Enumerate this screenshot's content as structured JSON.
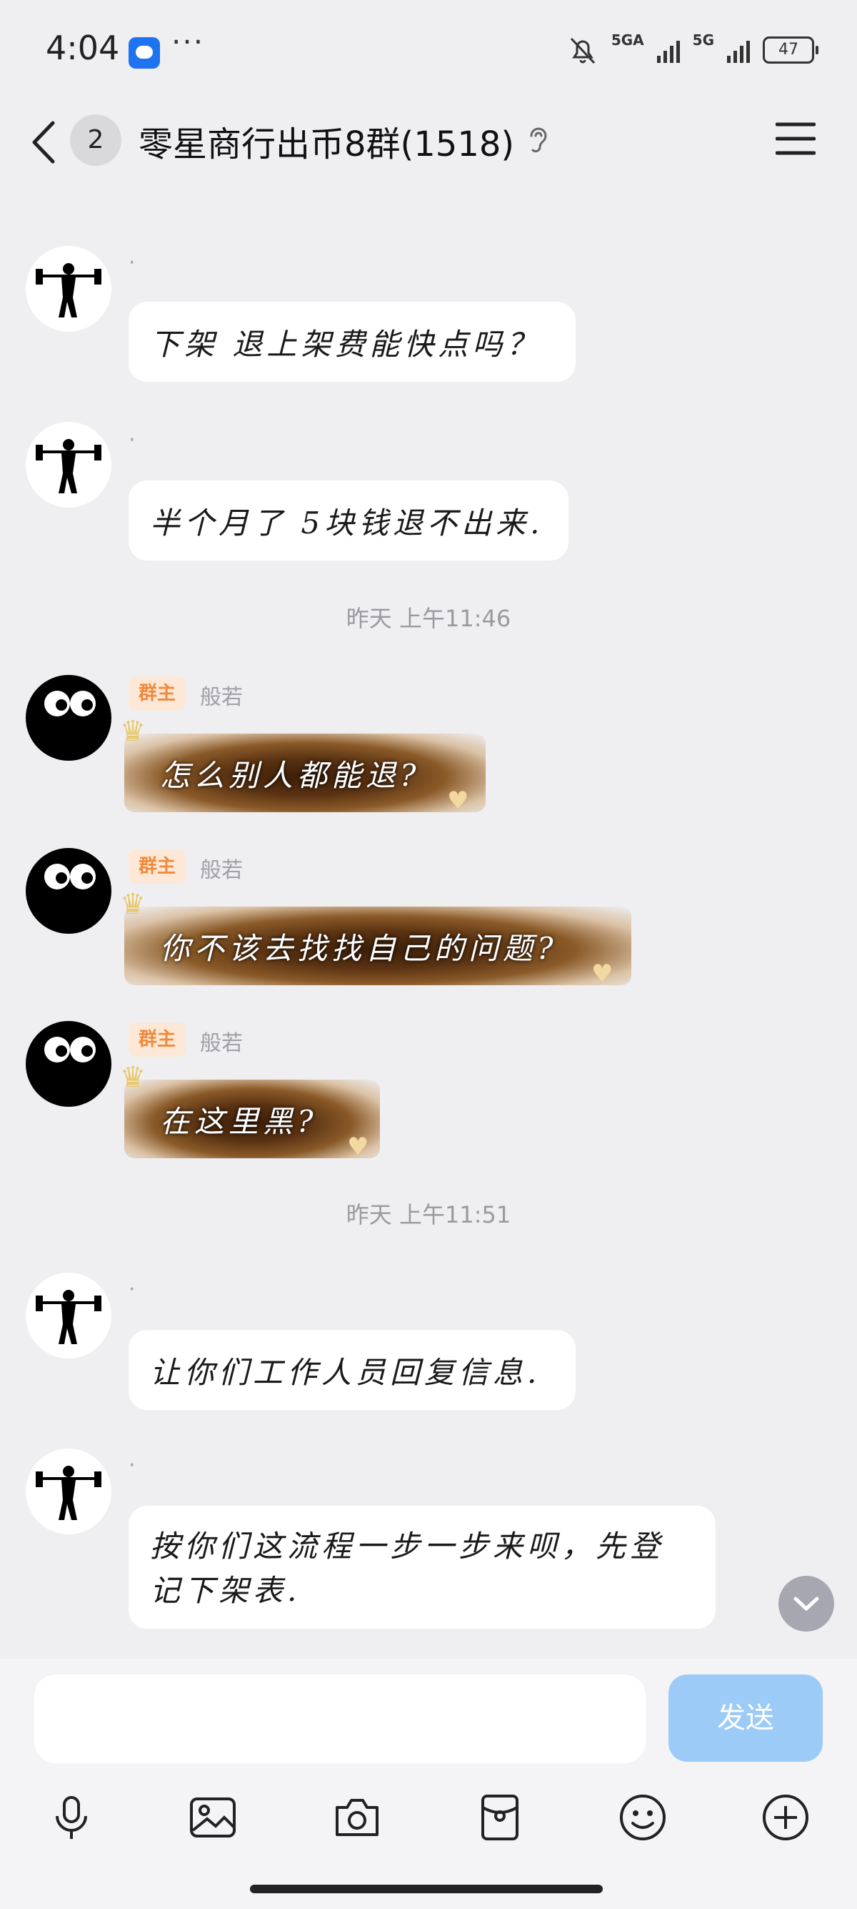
{
  "status_bar": {
    "time": "4:04",
    "more": "···",
    "network1": "5GA",
    "network2": "5G",
    "battery": "47"
  },
  "header": {
    "unread_count": "2",
    "title": "零星商行出币8群(1518)"
  },
  "timestamps": [
    "昨天 上午11:46",
    "昨天 上午11:51"
  ],
  "messages": [
    {
      "sender": "·",
      "text": "下架 退上架费能快点吗？"
    },
    {
      "sender": "·",
      "text": "半个月了 5块钱退不出来."
    },
    {
      "badge": "群主",
      "sender": "般若",
      "text": "怎么别人都能退?"
    },
    {
      "badge": "群主",
      "sender": "般若",
      "text": "你不该去找找自己的问题?"
    },
    {
      "badge": "群主",
      "sender": "般若",
      "text": "在这里黑?"
    },
    {
      "sender": "·",
      "text": "让你们工作人员回复信息."
    },
    {
      "sender": "·",
      "text_line1": "按你们这流程一步一步来呗，先登",
      "text_line2": "记下架表."
    }
  ],
  "input": {
    "placeholder": "",
    "send_label": "发送"
  },
  "toolbar": [
    "mic-icon",
    "image-icon",
    "camera-icon",
    "red-packet-icon",
    "emoji-icon",
    "plus-icon"
  ],
  "colors": {
    "background": "#efeff2",
    "send_button": "#9ccbf7",
    "owner_badge_bg": "#fde8d7",
    "owner_badge_text": "#f08a3c"
  }
}
